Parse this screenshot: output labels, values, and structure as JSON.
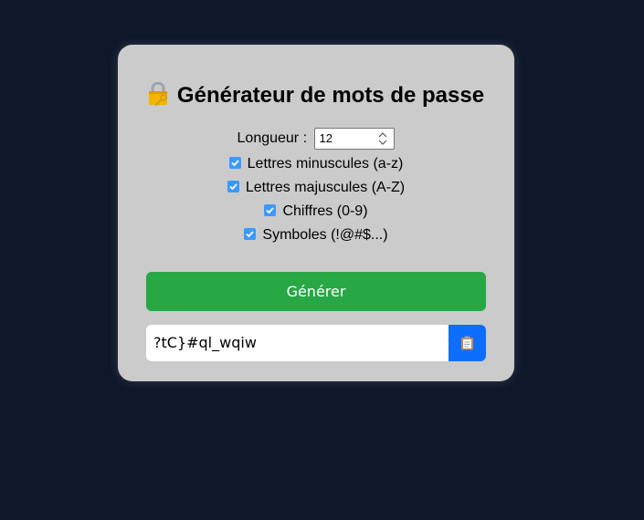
{
  "title": "Générateur de mots de passe",
  "title_icon": "lock-with-key-icon",
  "length": {
    "label": "Longueur :",
    "value": "12"
  },
  "options": [
    {
      "label": "Lettres minuscules (a-z)",
      "checked": true
    },
    {
      "label": "Lettres majuscules (A-Z)",
      "checked": true
    },
    {
      "label": "Chiffres (0-9)",
      "checked": true
    },
    {
      "label": "Symboles (!@#$...)",
      "checked": true
    }
  ],
  "generate_label": "Générer",
  "output": {
    "value": "?tC}#ql_wqiw",
    "copy_icon": "clipboard-icon"
  },
  "colors": {
    "background": "#0f172a",
    "card": "#cbcbcb",
    "generate_button": "#28a745",
    "copy_button": "#0d6efd",
    "checkbox": "#3b99fc"
  }
}
